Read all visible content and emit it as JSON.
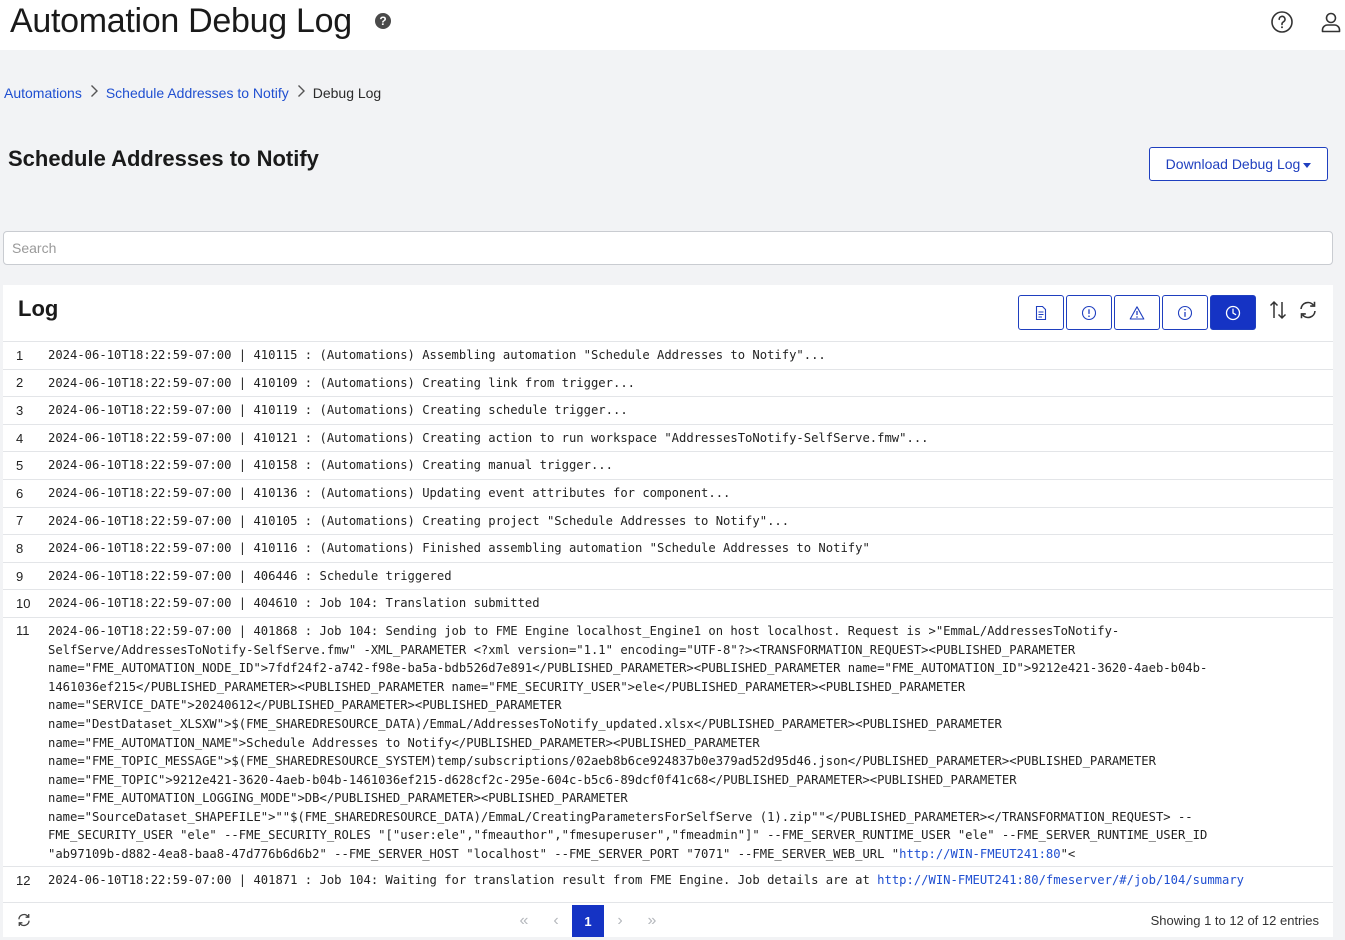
{
  "header": {
    "title": "Automation Debug Log",
    "help_glyph": "?",
    "icons": [
      "help-circle-icon",
      "user-icon"
    ]
  },
  "breadcrumb": {
    "items": [
      {
        "label": "Automations"
      },
      {
        "label": "Schedule Addresses to Notify"
      },
      {
        "label": "Debug Log"
      }
    ]
  },
  "section": {
    "title": "Schedule Addresses to Notify",
    "download_label": "Download Debug Log"
  },
  "search": {
    "placeholder": "Search",
    "value": ""
  },
  "log": {
    "title": "Log",
    "filters": [
      {
        "icon": "document-icon",
        "active": false
      },
      {
        "icon": "error-icon",
        "active": false
      },
      {
        "icon": "warning-icon",
        "active": false
      },
      {
        "icon": "info-icon",
        "active": false
      },
      {
        "icon": "clock-icon",
        "active": true
      }
    ],
    "rows": [
      {
        "num": "1",
        "text": "2024-06-10T18:22:59-07:00 | 410115 : (Automations) Assembling automation \"Schedule Addresses to Notify\"..."
      },
      {
        "num": "2",
        "text": "2024-06-10T18:22:59-07:00 | 410109 : (Automations) Creating link from trigger..."
      },
      {
        "num": "3",
        "text": "2024-06-10T18:22:59-07:00 | 410119 : (Automations) Creating schedule trigger..."
      },
      {
        "num": "4",
        "text": "2024-06-10T18:22:59-07:00 | 410121 : (Automations) Creating action to run workspace \"AddressesToNotify-SelfServe.fmw\"..."
      },
      {
        "num": "5",
        "text": "2024-06-10T18:22:59-07:00 | 410158 : (Automations) Creating manual trigger..."
      },
      {
        "num": "6",
        "text": "2024-06-10T18:22:59-07:00 | 410136 : (Automations) Updating event attributes for component..."
      },
      {
        "num": "7",
        "text": "2024-06-10T18:22:59-07:00 | 410105 : (Automations) Creating project \"Schedule Addresses to Notify\"..."
      },
      {
        "num": "8",
        "text": "2024-06-10T18:22:59-07:00 | 410116 : (Automations) Finished assembling automation \"Schedule Addresses to Notify\""
      },
      {
        "num": "9",
        "text": "2024-06-10T18:22:59-07:00 | 406446 : Schedule triggered"
      },
      {
        "num": "10",
        "text": "2024-06-10T18:22:59-07:00 | 404610 : Job 104: Translation submitted"
      },
      {
        "num": "11",
        "text": "2024-06-10T18:22:59-07:00 | 401868 : Job 104: Sending job to FME Engine localhost_Engine1 on host localhost. Request is >\"EmmaL/AddressesToNotify-\nSelfServe/AddressesToNotify-SelfServe.fmw\" -XML_PARAMETER <?xml version=\"1.1\" encoding=\"UTF-8\"?><TRANSFORMATION_REQUEST><PUBLISHED_PARAMETER\nname=\"FME_AUTOMATION_NODE_ID\">7fdf24f2-a742-f98e-ba5a-bdb526d7e891</PUBLISHED_PARAMETER><PUBLISHED_PARAMETER name=\"FME_AUTOMATION_ID\">9212e421-3620-4aeb-b04b-\n1461036ef215</PUBLISHED_PARAMETER><PUBLISHED_PARAMETER name=\"FME_SECURITY_USER\">ele</PUBLISHED_PARAMETER><PUBLISHED_PARAMETER\nname=\"SERVICE_DATE\">20240612</PUBLISHED_PARAMETER><PUBLISHED_PARAMETER\nname=\"DestDataset_XLSXW\">$(FME_SHAREDRESOURCE_DATA)/EmmaL/AddressesToNotify_updated.xlsx</PUBLISHED_PARAMETER><PUBLISHED_PARAMETER\nname=\"FME_AUTOMATION_NAME\">Schedule Addresses to Notify</PUBLISHED_PARAMETER><PUBLISHED_PARAMETER\nname=\"FME_TOPIC_MESSAGE\">$(FME_SHAREDRESOURCE_SYSTEM)temp/subscriptions/02aeb8b6ce924837b0e379ad52d95d46.json</PUBLISHED_PARAMETER><PUBLISHED_PARAMETER\nname=\"FME_TOPIC\">9212e421-3620-4aeb-b04b-1461036ef215-d628cf2c-295e-604c-b5c6-89dcf0f41c68</PUBLISHED_PARAMETER><PUBLISHED_PARAMETER\nname=\"FME_AUTOMATION_LOGGING_MODE\">DB</PUBLISHED_PARAMETER><PUBLISHED_PARAMETER\nname=\"SourceDataset_SHAPEFILE\">\"\"$(FME_SHAREDRESOURCE_DATA)/EmmaL/CreatingParametersForSelfServe (1).zip\"\"</PUBLISHED_PARAMETER></TRANSFORMATION_REQUEST> --\nFME_SECURITY_USER \"ele\" --FME_SECURITY_ROLES \"[\"user:ele\",\"fmeauthor\",\"fmesuperuser\",\"fmeadmin\"]\" --FME_SERVER_RUNTIME_USER \"ele\" --FME_SERVER_RUNTIME_USER_ID\n\"ab97109b-d882-4ea8-baa8-47d776b6d6b2\" --FME_SERVER_HOST \"localhost\" --FME_SERVER_PORT \"7071\" --FME_SERVER_WEB_URL \"",
        "link": "http://WIN-FMEUT241:80",
        "tail": "\"<"
      },
      {
        "num": "12",
        "text": "2024-06-10T18:22:59-07:00 | 401871 : Job 104: Waiting for translation result from FME Engine. Job details are at ",
        "link": "http://WIN-FMEUT241:80/fmeserver/#/job/104/summary",
        "tail": ""
      }
    ]
  },
  "pagination": {
    "current_page": "1",
    "first": "«",
    "prev": "‹",
    "next": "›",
    "last": "»",
    "summary": "Showing 1 to 12 of 12 entries"
  },
  "colors": {
    "accent": "#1533c4",
    "link": "#1f4fd1",
    "border": "#e3e5e8",
    "background": "#f2f3f5"
  }
}
